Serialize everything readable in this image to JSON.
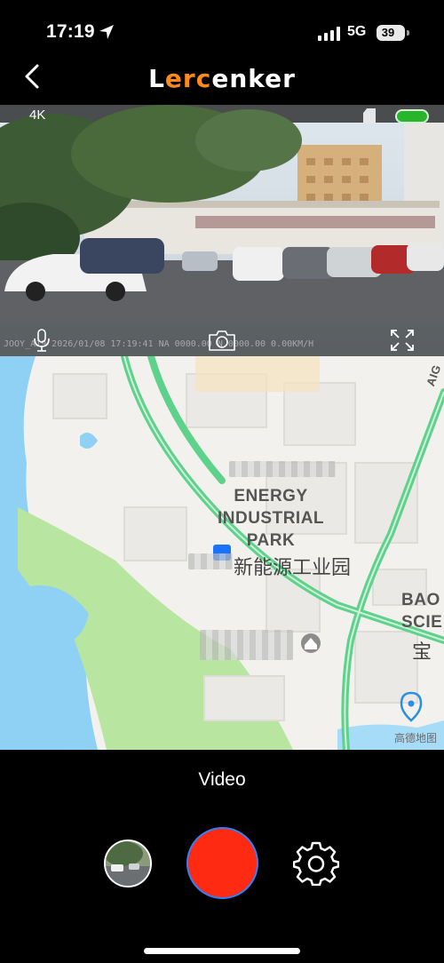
{
  "status_bar": {
    "time": "17:19",
    "network": "5G",
    "battery": "39",
    "icons": [
      "location-arrow-icon",
      "signal-icon",
      "battery-icon"
    ]
  },
  "header": {
    "back_icon": "chevron-left-icon",
    "logo_text": "Lercenker"
  },
  "video": {
    "resolution_label": "4K",
    "overlay_text": "JOOY_A19  2026/01/08 17:19:41 NA 0000.00 N 0000.00 0.00KM/H",
    "icons": [
      "microphone-icon",
      "camera-icon",
      "fullscreen-icon",
      "sd-card-icon",
      "recording-indicator"
    ],
    "indicator_color": "#27b52b"
  },
  "map": {
    "poi_label_en": "ENERGY\nINDUSTRIAL\nPARK",
    "poi_label_cn": "新能源工业园",
    "edge_label_en": "BAO\nSCIE",
    "edge_label_cn": "宝",
    "road_label": "AIG",
    "watermark": "高德地图",
    "colors": {
      "road": "#5ed18a",
      "water": "#8fd0f5",
      "park": "#b8e6a0",
      "location": "#1a73ff"
    }
  },
  "mode_label": "Video",
  "controls": {
    "record_color": "#ff2a12",
    "icons": [
      "gallery-thumbnail",
      "record-button",
      "settings-icon"
    ]
  }
}
